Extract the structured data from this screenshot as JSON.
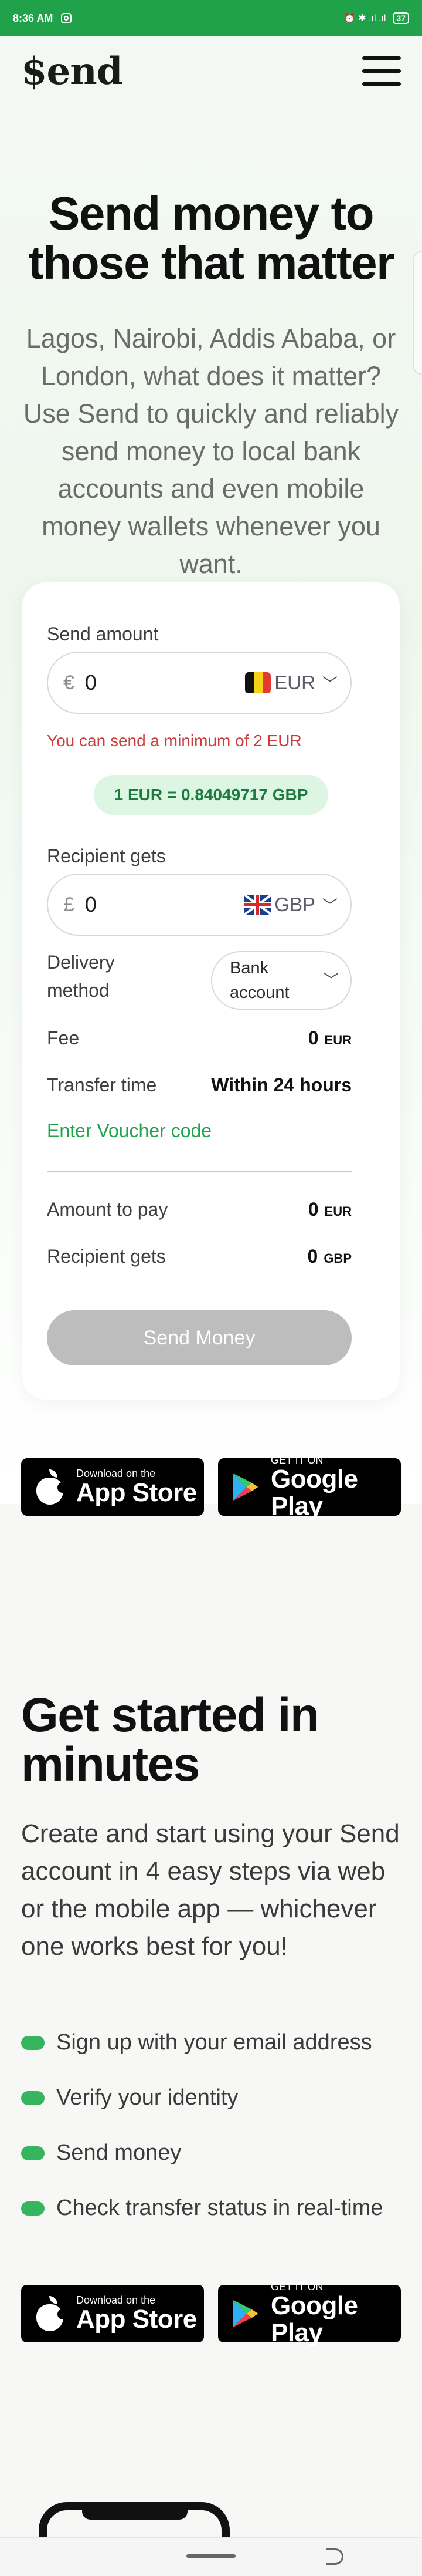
{
  "status_bar": {
    "time": "8:36 AM",
    "indicators": "⏰ ✱ .ıl .ıl",
    "battery": "37"
  },
  "header": {
    "logo": "$end"
  },
  "hero": {
    "title": "Send money to those that matter",
    "subtitle": "Lagos, Nairobi, Addis Ababa, or London, what does it matter? Use Send to quickly and reliably send money to local bank accounts and even mobile money wallets whenever you want."
  },
  "calculator": {
    "send_amount_label": "Send amount",
    "send_currency_symbol": "€",
    "send_value": "0",
    "send_currency": "EUR",
    "minimum_note": "You can send a minimum of 2 EUR",
    "rate": "1 EUR = 0.84049717 GBP",
    "recipient_label": "Recipient gets",
    "recipient_currency_symbol": "£",
    "recipient_value": "0",
    "recipient_currency": "GBP",
    "delivery_label": "Delivery method",
    "delivery_value": "Bank account",
    "fee_label": "Fee",
    "fee_value": "0",
    "fee_currency": "EUR",
    "transfer_time_label": "Transfer time",
    "transfer_time_value": "Within 24 hours",
    "voucher_link": "Enter Voucher code",
    "amount_to_pay_label": "Amount to pay",
    "amount_to_pay_value": "0",
    "amount_to_pay_currency": "EUR",
    "recipient_gets_label": "Recipient gets",
    "recipient_gets_value": "0",
    "recipient_gets_currency": "GBP",
    "send_button": "Send Money"
  },
  "store_badges": {
    "app_store_small": "Download on the",
    "app_store_big": "App Store",
    "google_play_small": "GET IT ON",
    "google_play_big": "Google Play"
  },
  "get_started": {
    "title": "Get started in minutes",
    "subtitle": "Create and start using your Send account in 4 easy steps via web or the mobile app — whichever one works best for you!",
    "steps": [
      "Sign up with your email address",
      "Verify your identity",
      "Send money",
      "Check transfer status in real-time"
    ]
  },
  "colors": {
    "brand_green": "#1fa24a",
    "error_red": "#cf3b3b",
    "rate_pill_bg": "#dcf6e3",
    "disabled_button": "#bdbdbd"
  }
}
